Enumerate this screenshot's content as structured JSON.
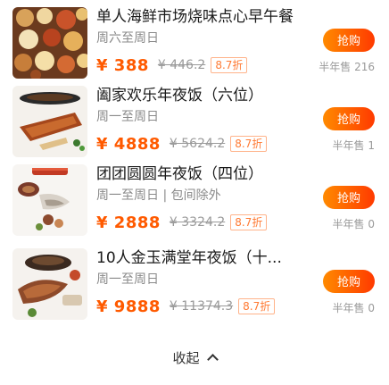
{
  "deals": [
    {
      "title": "单人海鲜市场烧味点心早午餐",
      "subtitle": "周六至周日",
      "price": "¥ 388",
      "original_price": "¥ 446.2",
      "discount": "8.7折",
      "buy_label": "抢购",
      "sold": "半年售 216",
      "image_icon": "dim-sum-platter-image"
    },
    {
      "title": "阖家欢乐年夜饭（六位）",
      "subtitle": "周一至周日",
      "price": "¥ 4888",
      "original_price": "¥ 5624.2",
      "discount": "8.7折",
      "buy_label": "抢购",
      "sold": "半年售 1",
      "image_icon": "roast-dish-image"
    },
    {
      "title": "团团圆圆年夜饭（四位）",
      "subtitle": "周一至周日 | 包间除外",
      "price": "¥ 2888",
      "original_price": "¥ 3324.2",
      "discount": "8.7折",
      "buy_label": "抢购",
      "sold": "半年售 0",
      "image_icon": "seafood-dish-image"
    },
    {
      "title": "10人金玉满堂年夜饭（十...",
      "subtitle": "周一至周日",
      "price": "¥ 9888",
      "original_price": "¥ 11374.3",
      "discount": "8.7折",
      "buy_label": "抢购",
      "sold": "半年售 0",
      "image_icon": "banquet-dish-image"
    }
  ],
  "footer": {
    "collapse_label": "收起"
  },
  "colors": {
    "price": "#ff5a00",
    "buy_button_start": "#ff8a00",
    "buy_button_end": "#ff3a00",
    "muted_text": "#8a8a8a"
  }
}
